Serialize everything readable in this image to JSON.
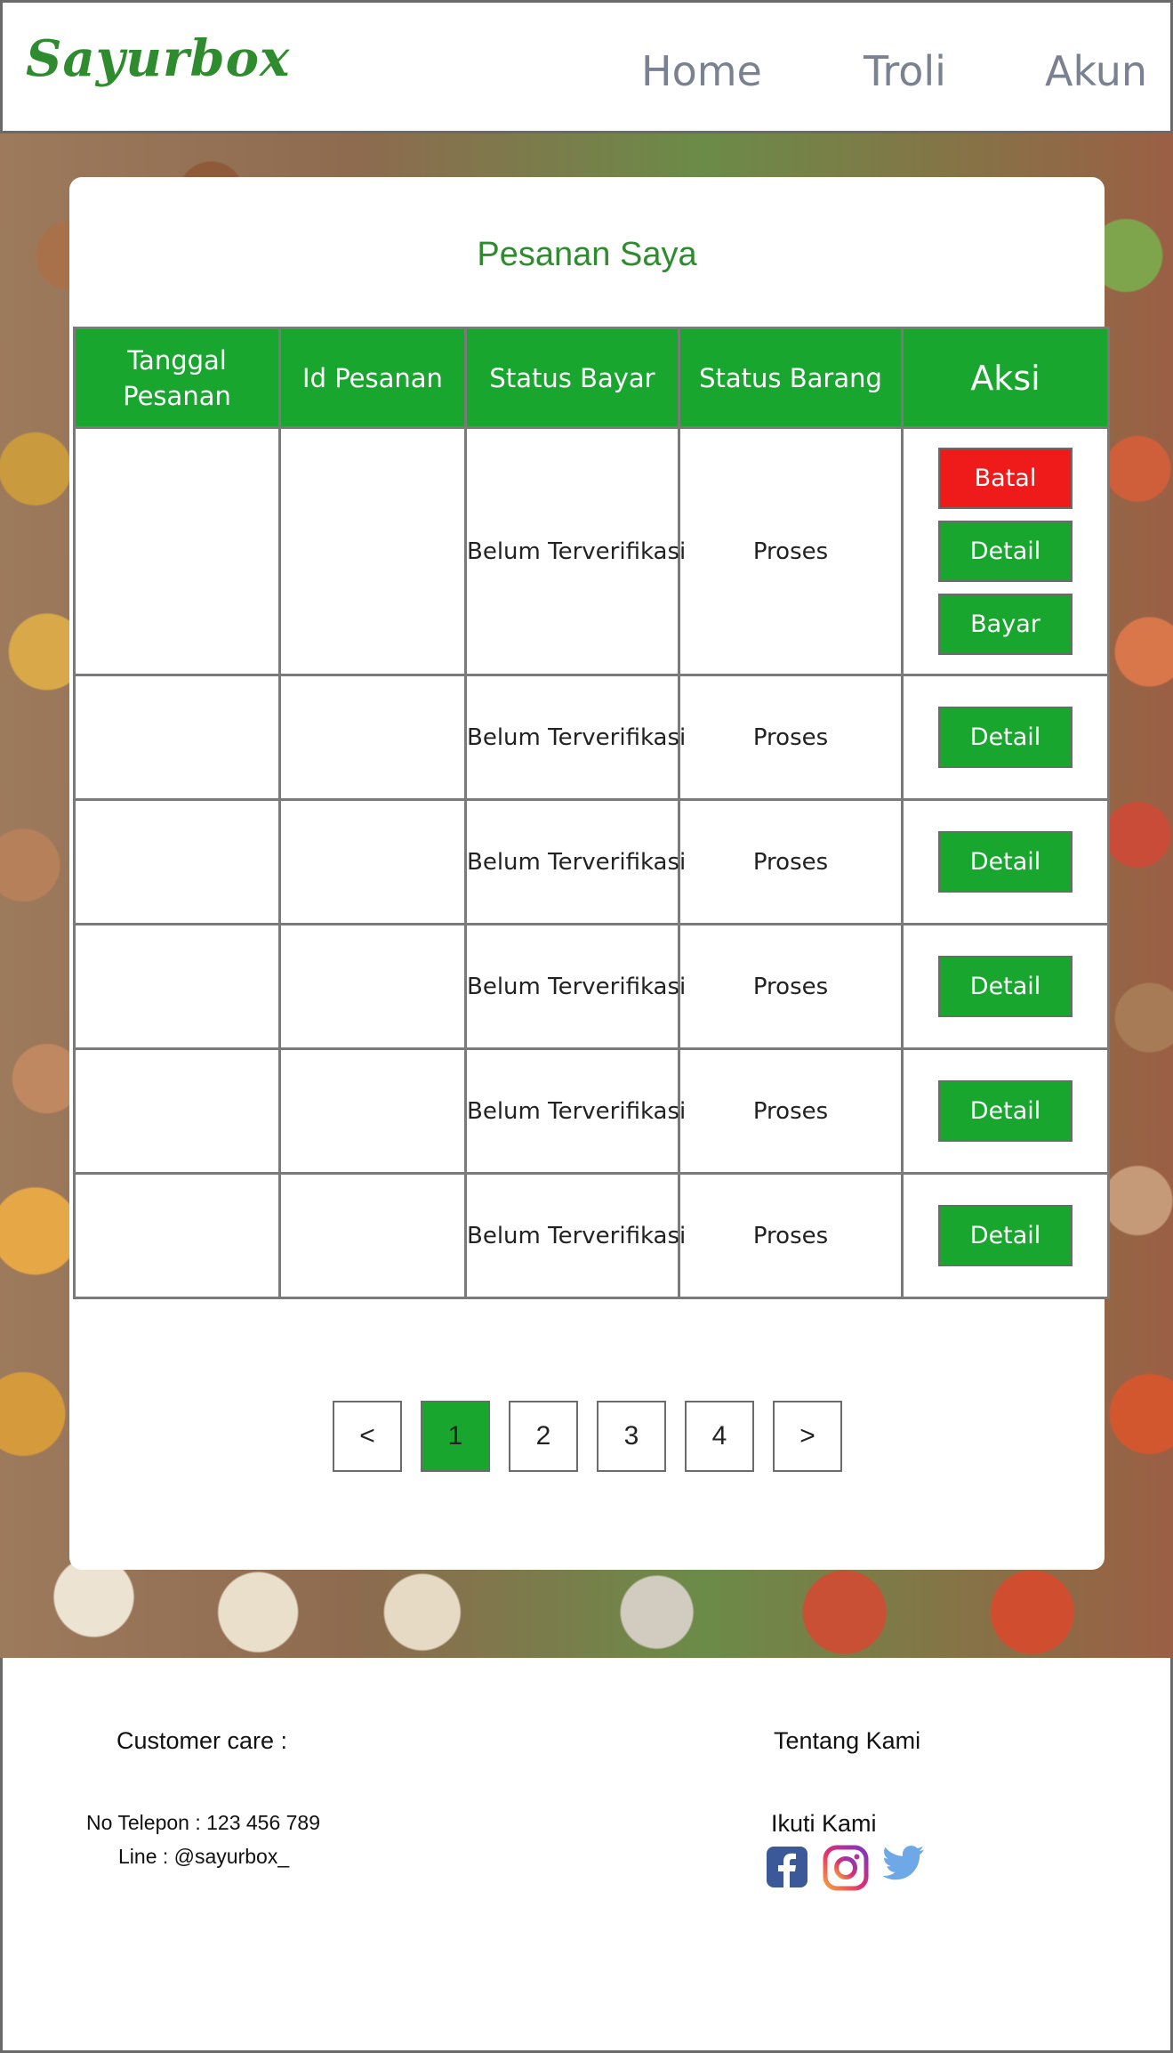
{
  "header": {
    "logo": "Sayurbox",
    "nav": [
      "Home",
      "Troli",
      "Akun"
    ]
  },
  "main": {
    "title": "Pesanan Saya",
    "table": {
      "headers": [
        "Tanggal Pesanan",
        "Id Pesanan",
        "Status Bayar",
        "Status Barang",
        "Aksi"
      ],
      "rows": [
        {
          "tanggal": "",
          "id": "",
          "status_bayar": "Belum Terverifikasi",
          "status_barang": "Proses",
          "actions": [
            "Batal",
            "Detail",
            "Bayar"
          ]
        },
        {
          "tanggal": "",
          "id": "",
          "status_bayar": "Belum Terverifikasi",
          "status_barang": "Proses",
          "actions": [
            "Detail"
          ]
        },
        {
          "tanggal": "",
          "id": "",
          "status_bayar": "Belum Terverifikasi",
          "status_barang": "Proses",
          "actions": [
            "Detail"
          ]
        },
        {
          "tanggal": "",
          "id": "",
          "status_bayar": "Belum Terverifikasi",
          "status_barang": "Proses",
          "actions": [
            "Detail"
          ]
        },
        {
          "tanggal": "",
          "id": "",
          "status_bayar": "Belum Terverifikasi",
          "status_barang": "Proses",
          "actions": [
            "Detail"
          ]
        },
        {
          "tanggal": "",
          "id": "",
          "status_bayar": "Belum Terverifikasi",
          "status_barang": "Proses",
          "actions": [
            "Detail"
          ]
        }
      ]
    },
    "pagination": {
      "prev": "<",
      "pages": [
        "1",
        "2",
        "3",
        "4"
      ],
      "next": ">",
      "current": "1"
    }
  },
  "footer": {
    "customer_care": "Customer care :",
    "phone": "No Telepon : 123 456 789",
    "line": "Line : @sayurbox_",
    "about": "Tentang Kami",
    "follow": "Ikuti Kami",
    "social_icons": [
      "facebook-icon",
      "instagram-icon",
      "twitter-icon"
    ]
  },
  "colors": {
    "brand_green": "#19a62f",
    "logo_green": "#2e8b2e",
    "danger_red": "#ef1b1b",
    "nav_gray": "#7a8191"
  }
}
